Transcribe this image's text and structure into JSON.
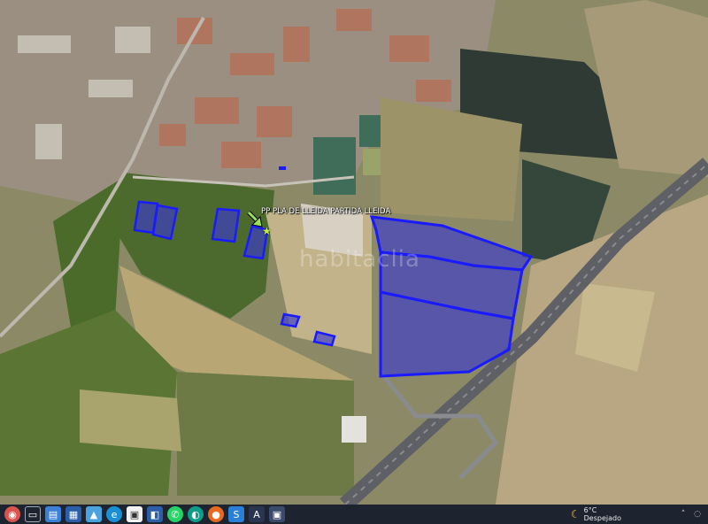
{
  "map": {
    "placemark_label": "PP PLA DE LLEIDA PARTIDA LLEIDA",
    "watermark": "habitaclia",
    "parcel_color": "#1a1aff",
    "parcel_fill": "#3a3acc",
    "marker_color": "#9be05a"
  },
  "taskbar": {
    "icons": [
      "windows-start-icon",
      "task-view-icon",
      "file-explorer-icon",
      "calendar-icon",
      "photos-icon",
      "edge-icon",
      "store-icon",
      "files-icon",
      "whatsapp-icon",
      "browser-icon",
      "firefox-icon",
      "app-s-icon",
      "app-a-icon",
      "app-b-icon"
    ],
    "weather_temp": "6°C",
    "weather_desc": "Despejado"
  }
}
